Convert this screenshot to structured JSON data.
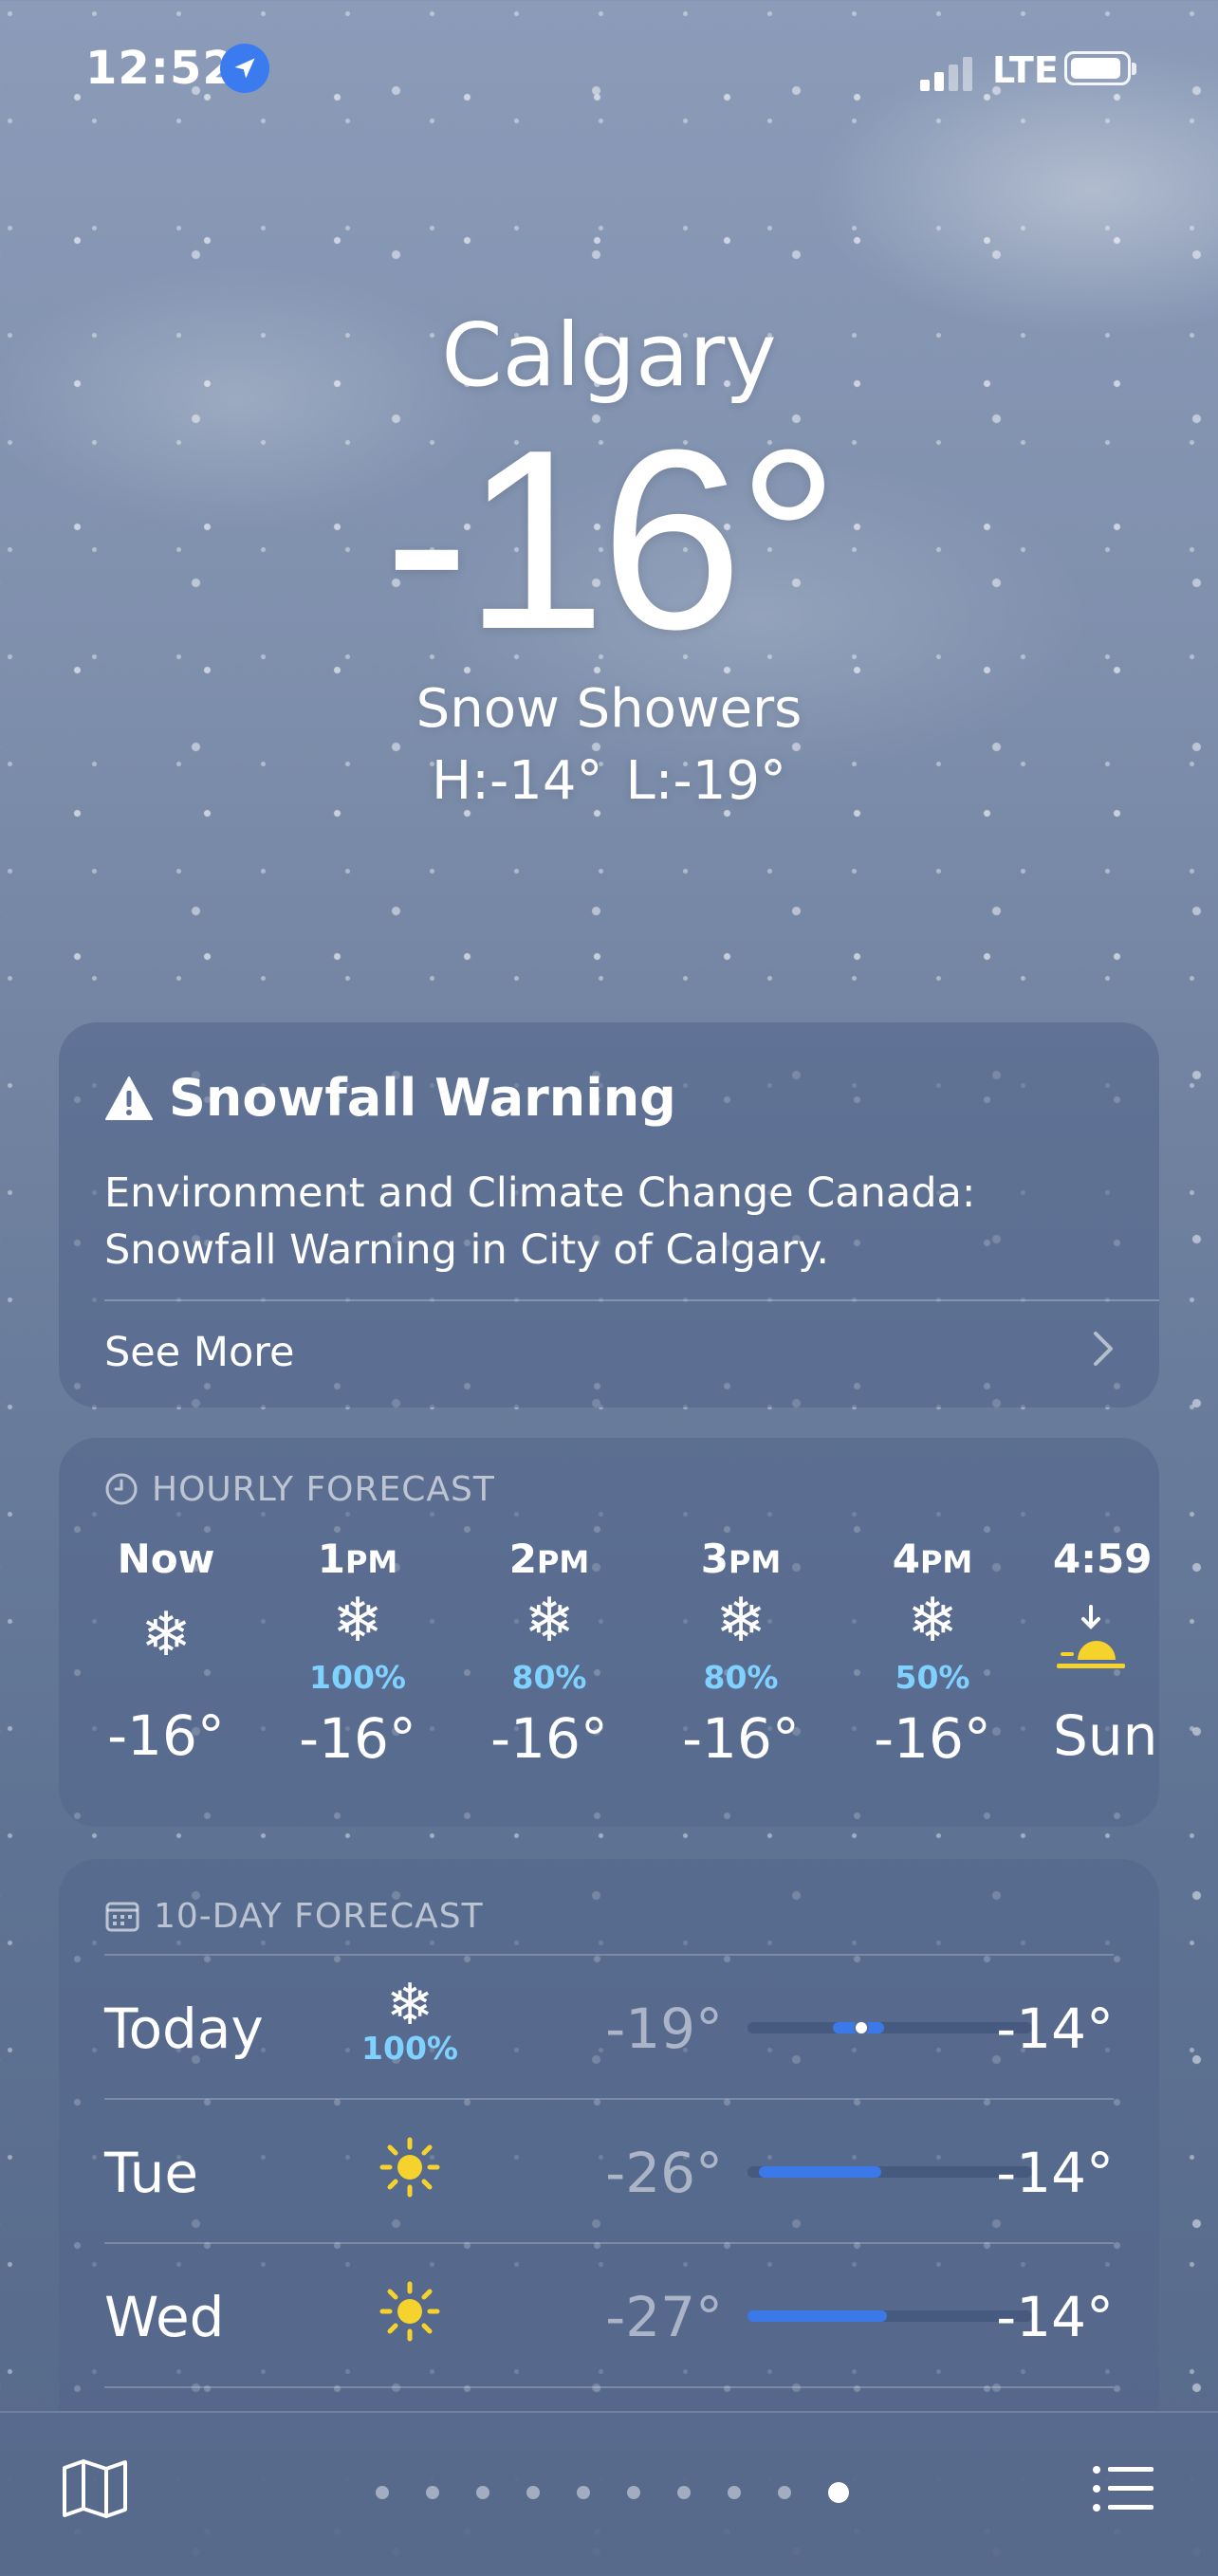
{
  "status_bar": {
    "time": "12:52",
    "network": "LTE"
  },
  "location": {
    "city": "Calgary",
    "temperature": "-16°",
    "condition": "Snow Showers",
    "high": "H:-14°",
    "low": "L:-19°"
  },
  "alert": {
    "title": "Snowfall Warning",
    "body": "Environment and Climate Change Canada: Snowfall Warning in City of Calgary.",
    "see_more": "See More"
  },
  "hourly": {
    "label": "HOURLY FORECAST",
    "hours": [
      {
        "time": "Now",
        "icon": "snowflake-icon",
        "precip": "",
        "temp": "-16°"
      },
      {
        "time": "1",
        "suffix": "PM",
        "icon": "snowflake-icon",
        "precip": "100%",
        "temp": "-16°"
      },
      {
        "time": "2",
        "suffix": "PM",
        "icon": "snowflake-icon",
        "precip": "80%",
        "temp": "-16°"
      },
      {
        "time": "3",
        "suffix": "PM",
        "icon": "snowflake-icon",
        "precip": "80%",
        "temp": "-16°"
      },
      {
        "time": "4",
        "suffix": "PM",
        "icon": "snowflake-icon",
        "precip": "50%",
        "temp": "-16°"
      },
      {
        "time": "4:59",
        "icon": "sunset-icon",
        "precip": "",
        "temp": "Sun"
      }
    ]
  },
  "daily": {
    "label": "10-DAY FORECAST",
    "days": [
      {
        "day": "Today",
        "icon": "snowflake-icon",
        "precip": "100%",
        "low": "-19°",
        "high": "-14°",
        "range_start": 0.3,
        "range_end": 0.48,
        "current": 0.4
      },
      {
        "day": "Tue",
        "icon": "sun-icon",
        "precip": "",
        "low": "-26°",
        "high": "-14°",
        "range_start": 0.04,
        "range_end": 0.47
      },
      {
        "day": "Wed",
        "icon": "sun-icon",
        "precip": "",
        "low": "-27°",
        "high": "-14°",
        "range_start": 0.0,
        "range_end": 0.49
      }
    ]
  },
  "page_indicator": {
    "count": 10,
    "active_index": 9
  },
  "colors": {
    "accent_blue": "#3b79e8",
    "precip_cyan": "#7fd2ff",
    "sun_yellow": "#f5d22c"
  }
}
